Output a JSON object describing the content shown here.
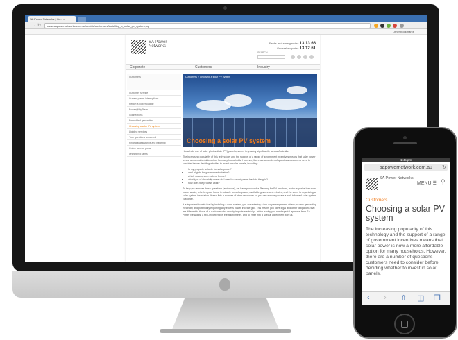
{
  "desktop": {
    "browser": {
      "tab_title": "SA Power Networks | Ho... ×",
      "url": "www.sapowernetworks.com.au/centric/customers/installing_a_solar_pv_system.jsp",
      "bookmarks_label": "Other bookmarks"
    },
    "site": {
      "logo_text": "SA Power Networks",
      "faults_label": "Faults and emergencies",
      "faults_number": "13 13 66",
      "enquiries_label": "General enquiries",
      "enquiries_number": "13 12 61",
      "search_label": "SEARCH",
      "nav": [
        "Corporate",
        "Customers",
        "Industry"
      ],
      "sidebar_heading": "Customers",
      "sidebar_items": [
        "Customer service",
        "Current power interruptions",
        "Report a power outage",
        "Power@MyPlace",
        "Connections",
        "Embedded generation",
        "Choosing a solar PV system",
        "Lighting services",
        "Your questions answered",
        "Financial assistance and hardship",
        "Online service portal",
        "Unmetered tariffs"
      ],
      "hero_breadcrumb": "Customers > Choosing a solar PV system",
      "hero_title": "Choosing a solar PV system",
      "body_intro": "Household use of solar photovoltaic (PV) panel systems is growing significantly across Australia.",
      "body_p1": "The increasing popularity of this technology and the support of a range of government incentives means that solar power is now a more affordable option for many households. However, there are a number of questions customers need to consider before deciding whether to invest in solar panels, including:",
      "bullets": [
        "Is my property suitable for solar power?",
        "am I eligible for government rebates?",
        "which solar system is best for me?",
        "what type of electricity meter do I need to export power back to the grid?",
        "how does the process work?"
      ],
      "body_p2": "To help you answer these questions (and more), we have produced a Planning for PV brochure, which explains how solar power works, whether your home is suitable for solar power, available government rebates, and the steps to organising a solar system installation. It also lists a number of other resources so you can ensure you are a well-informed solar system customer.",
      "body_p3": "It is important to note that by installing a solar system, you are entering a two-way arrangement where you are generating electricity and potentially exporting any excess power into the grid. This means you have legal and other obligations that are different to those of a customer who merely imports electricity - which is why you need special approval from SA Power Networks, a two-import/export electricity meter, and to enter into a special agreement with us."
    }
  },
  "phone": {
    "time": "1:45 pm",
    "url": "sapowernetwork.com.au",
    "logo_text": "SA Power Networks",
    "menu_label": "MENU",
    "breadcrumb": "Customers",
    "title": "Choosing a solar PV system",
    "body": "The increasing popularity of this technology and the support of a range of government incentives means that solar power is now a more affordable option for many households. However, there are a number of questions customers need to consider before deciding whether to invest in solar panels."
  },
  "colors": {
    "accent_orange": "#f07b1c",
    "browser_blue": "#3a6fb0",
    "ios_blue": "#4a76b5"
  }
}
